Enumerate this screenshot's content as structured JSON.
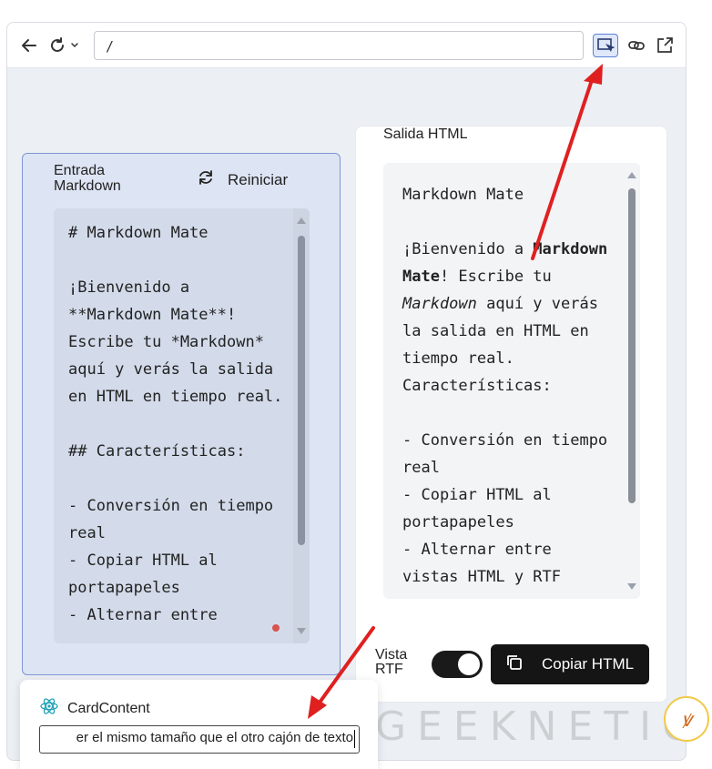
{
  "toolbar": {
    "url": "/"
  },
  "left_panel": {
    "title": "Entrada Markdown",
    "reset_label": "Reiniciar",
    "markdown_text": "# Markdown Mate\n\n¡Bienvenido a **Markdown Mate**! Escribe tu *Markdown* aquí y verás la salida en HTML en tiempo real.\n\n## Características:\n\n- Conversión en tiempo real\n- Copiar HTML al portapapeles\n- Alternar entre"
  },
  "right_panel": {
    "title": "Salida HTML",
    "heading": "Markdown Mate",
    "intro_prefix": "¡Bienvenido a ",
    "intro_bold": "Markdown Mate",
    "intro_mid": "! Escribe tu ",
    "intro_italic": "Markdown",
    "intro_suffix": " aquí y verás la salida en HTML en tiempo real.",
    "section": "Características:",
    "items": [
      "- Conversión en tiempo real",
      "- Copiar HTML al portapapeles",
      "- Alternar entre",
      "vistas HTML y RTF"
    ],
    "vista_label": "Vista RTF",
    "toggle_on": true,
    "copy_label": "Copiar HTML"
  },
  "card_content": {
    "label": "CardContent",
    "input_value": "er el mismo tamaño que el otro cajón de texto"
  },
  "watermark": {
    "text": "GEEKNETIC"
  },
  "colors": {
    "annotation_red": "#e02020",
    "selection_blue": "#5b7fd6",
    "panel_blue_bg": "#dde4f3"
  }
}
